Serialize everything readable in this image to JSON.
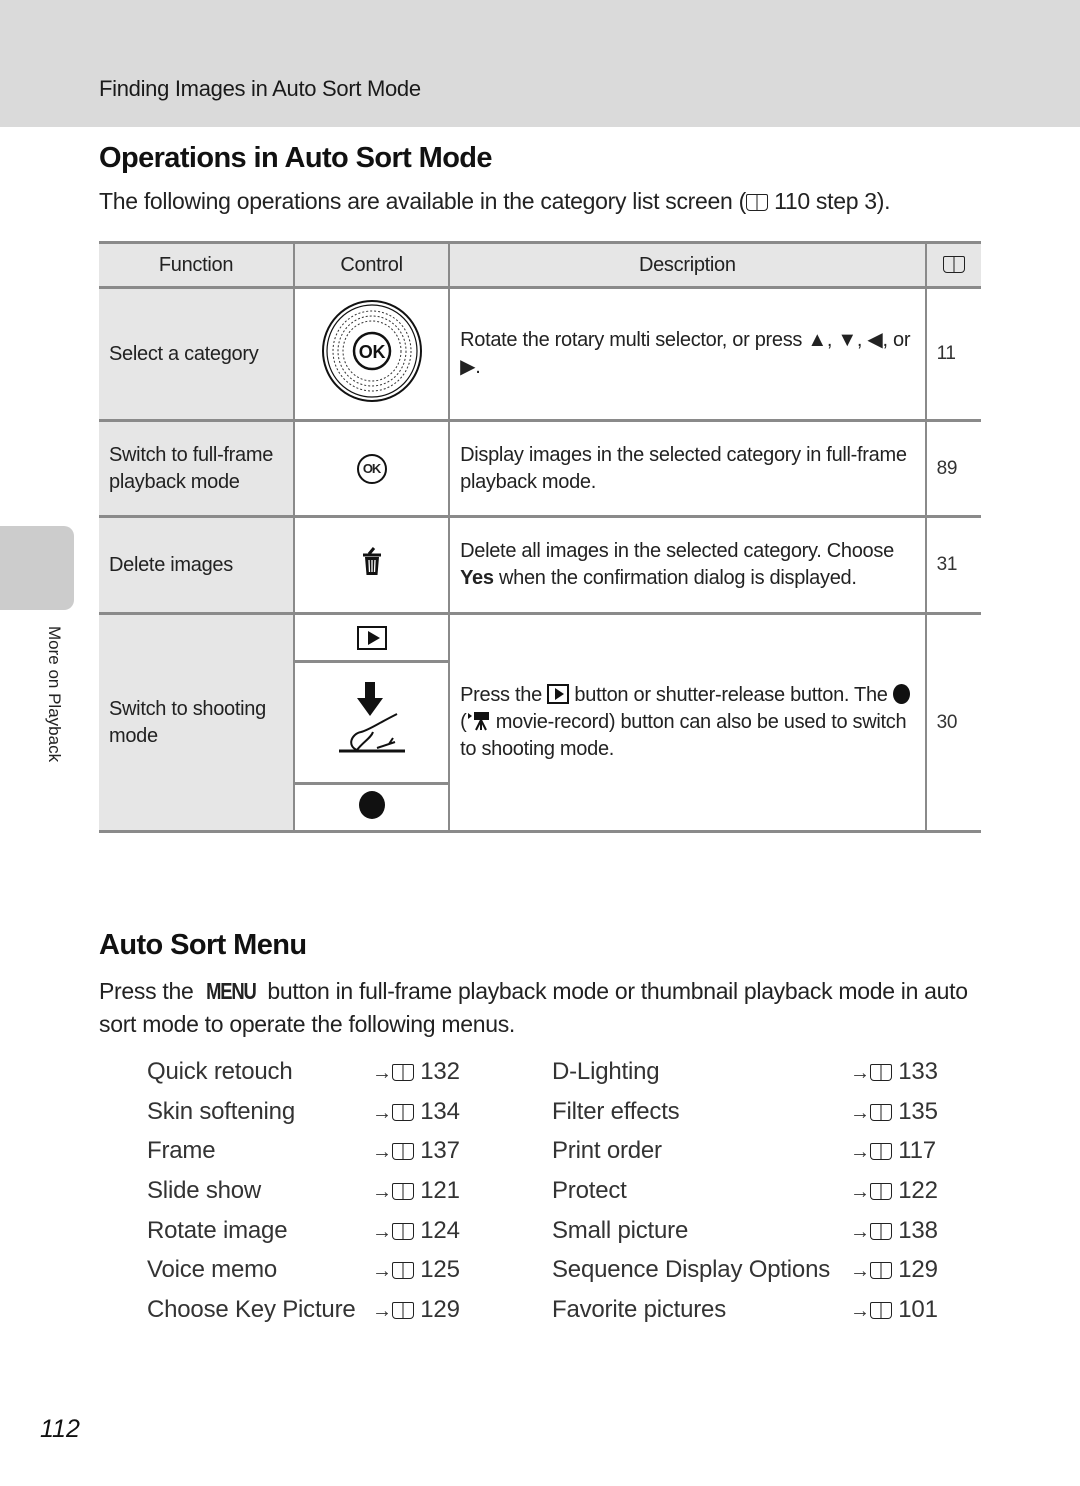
{
  "header": {
    "breadcrumb": "Finding Images in Auto Sort Mode"
  },
  "side_tab": {
    "label": "More on Playback"
  },
  "section1": {
    "title": "Operations in Auto Sort Mode",
    "intro_before": "The following operations are available in the category list screen (",
    "intro_ref": "110 step 3",
    "intro_after": ").",
    "table": {
      "headers": {
        "function": "Function",
        "control": "Control",
        "description": "Description",
        "page_icon": "book-icon"
      },
      "rows": [
        {
          "function": "Select a category",
          "control_icon": "rotary-multi-selector-icon",
          "description_before": "Rotate the rotary multi selector, or press ",
          "arrows": [
            "▲",
            "▼",
            "◀",
            "▶"
          ],
          "description_sep1": ", ",
          "description_sep2": ", ",
          "description_or": ", or ",
          "description_end": ".",
          "page": "11"
        },
        {
          "function": "Switch to full-frame playback mode",
          "control_icon": "ok-button-icon",
          "control_glyph": "OK",
          "description": "Display images in the selected category in full-frame playback mode.",
          "page": "89"
        },
        {
          "function": "Delete images",
          "control_icon": "trash-icon",
          "description_before": "Delete all images in the selected category. Choose ",
          "description_bold": "Yes",
          "description_after": " when the confirmation dialog is displayed.",
          "page": "31"
        },
        {
          "function": "Switch to shooting mode",
          "control_icons": [
            "playback-button-icon",
            "shutter-release-icon",
            "movie-record-button-icon"
          ],
          "description_part1": "Press the ",
          "description_part2": " button or shutter-release button. The ",
          "description_part3": " (",
          "description_part4": " movie-record) button can also be used to switch to shooting mode.",
          "page": "30"
        }
      ]
    }
  },
  "section2": {
    "title": "Auto Sort Menu",
    "intro_before": "Press the ",
    "menu_glyph": "MENU",
    "intro_after": " button in full-frame playback mode or thumbnail playback mode in auto sort mode to operate the following menus.",
    "ref_arrow": "→",
    "items": [
      {
        "left": "Quick retouch",
        "left_page": "132",
        "right": "D-Lighting",
        "right_page": "133"
      },
      {
        "left": "Skin softening",
        "left_page": "134",
        "right": "Filter effects",
        "right_page": "135"
      },
      {
        "left": "Frame",
        "left_page": "137",
        "right": "Print order",
        "right_page": "117"
      },
      {
        "left": "Slide show",
        "left_page": "121",
        "right": "Protect",
        "right_page": "122"
      },
      {
        "left": "Rotate image",
        "left_page": "124",
        "right": "Small picture",
        "right_page": "138"
      },
      {
        "left": "Voice memo",
        "left_page": "125",
        "right": "Sequence Display Options",
        "right_page": "129"
      },
      {
        "left": "Choose Key Picture",
        "left_page": "129",
        "right": "Favorite pictures",
        "right_page": "101"
      }
    ]
  },
  "footer": {
    "page_number": "112"
  }
}
